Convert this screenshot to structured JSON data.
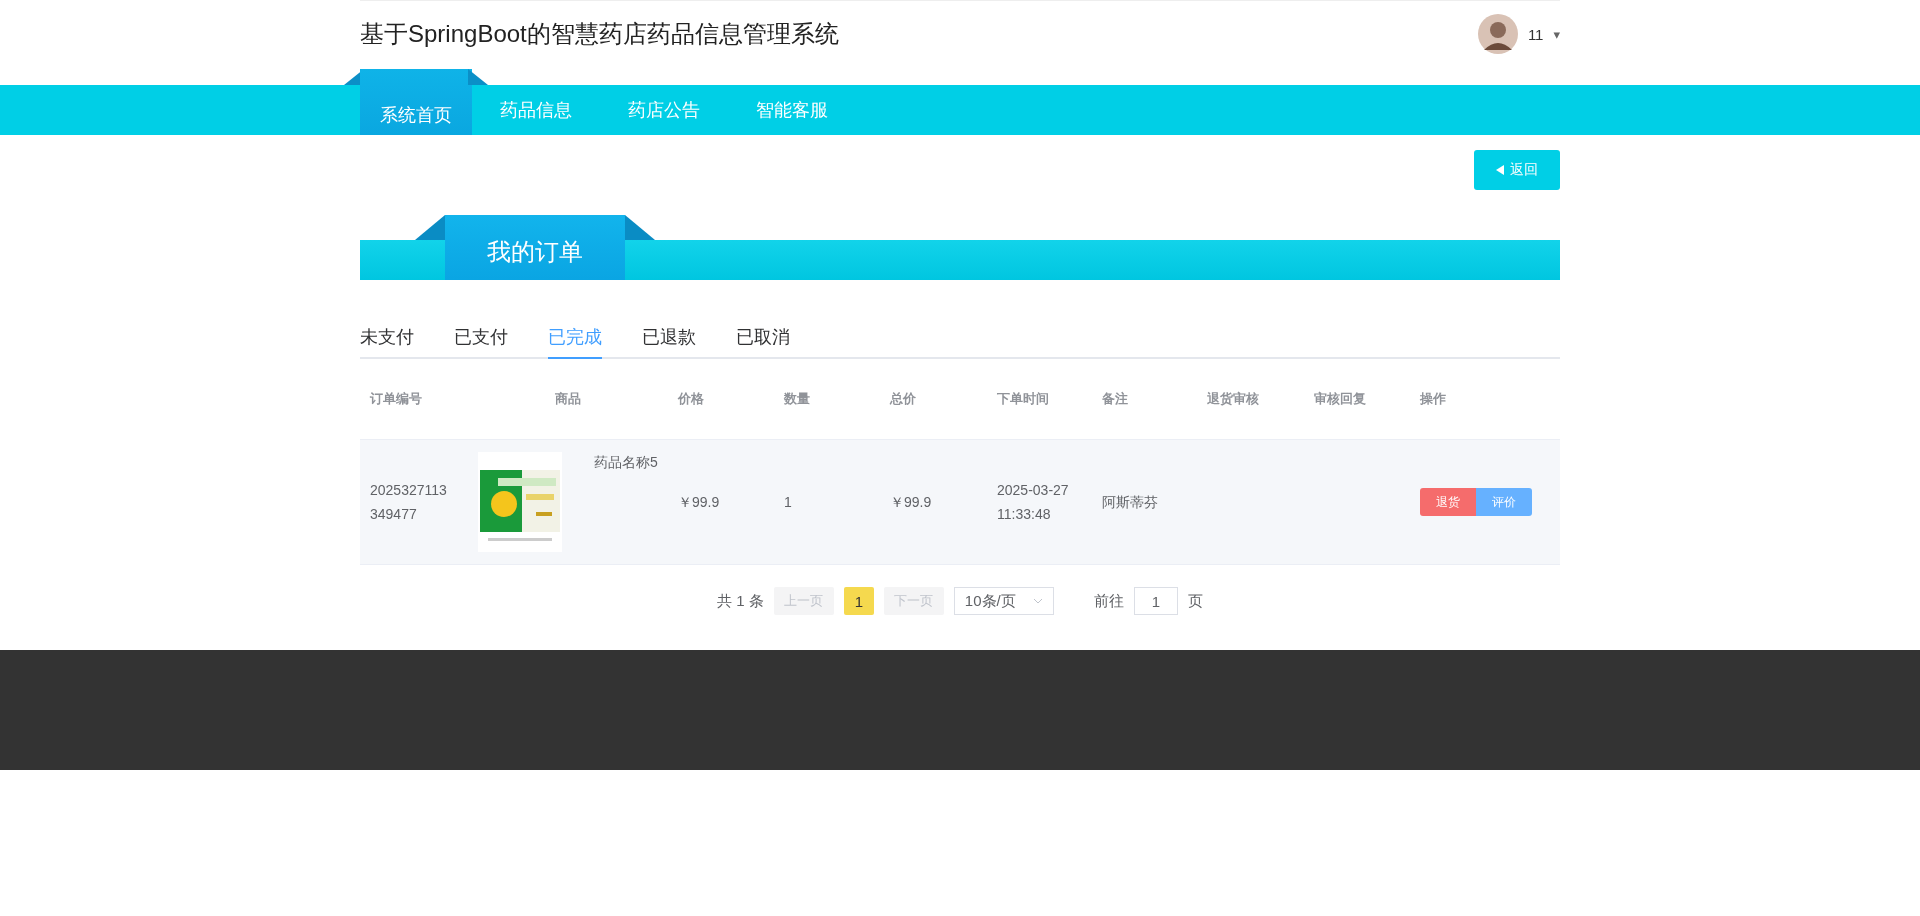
{
  "header": {
    "title": "基于SpringBoot的智慧药店药品信息管理系统",
    "user": {
      "name": "11",
      "caret": "▾"
    }
  },
  "nav": [
    {
      "label": "系统首页",
      "selected": true
    },
    {
      "label": "药品信息",
      "selected": false
    },
    {
      "label": "药店公告",
      "selected": false
    },
    {
      "label": "智能客服",
      "selected": false
    }
  ],
  "back_button": {
    "label": "返回"
  },
  "section_title": "我的订单",
  "order_tabs": [
    {
      "label": "未支付",
      "selected": false
    },
    {
      "label": "已支付",
      "selected": false
    },
    {
      "label": "已完成",
      "selected": true
    },
    {
      "label": "已退款",
      "selected": false
    },
    {
      "label": "已取消",
      "selected": false
    }
  ],
  "table": {
    "columns": [
      "订单编号",
      "商品",
      "价格",
      "数量",
      "总价",
      "下单时间",
      "备注",
      "退货审核",
      "审核回复",
      "操作"
    ],
    "rows": [
      {
        "order_no": "2025327113349477",
        "product_name": "药品名称5",
        "price": "￥99.9",
        "quantity": "1",
        "total": "￥99.9",
        "time": "2025-03-27 11:33:48",
        "note": "阿斯蒂芬",
        "actions": [
          {
            "label": "退货",
            "kind": "danger"
          },
          {
            "label": "评价",
            "kind": "primary"
          }
        ]
      }
    ]
  },
  "pagination": {
    "total": "共 1 条",
    "prev": "上一页",
    "pages": [
      {
        "label": "1",
        "selected": true
      }
    ],
    "next": "下一页",
    "page_size": "10条/页",
    "goto_label": "前往",
    "goto_value": "1",
    "goto_suffix": "页"
  }
}
